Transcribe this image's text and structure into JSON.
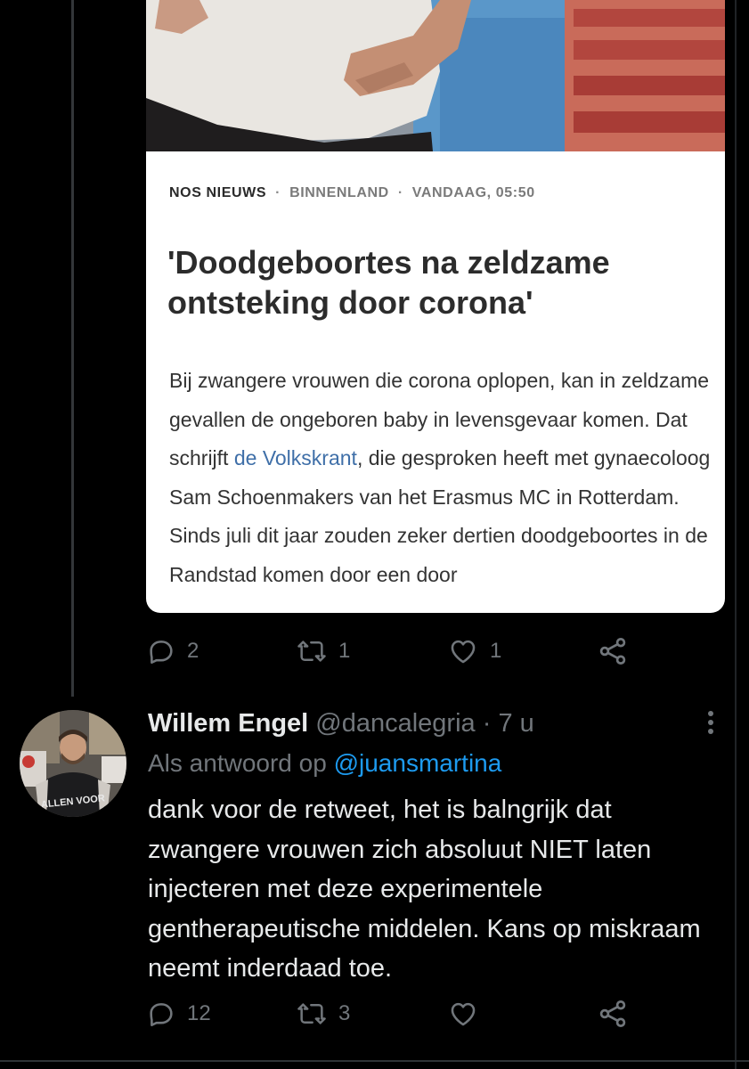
{
  "card": {
    "source": "NOS NIEUWS",
    "section": "BINNENLAND",
    "time": "VANDAAG, 05:50",
    "separator": "·",
    "title": "'Doodgeboortes na zeldzame ontsteking door corona'",
    "body_part1": "Bij zwangere vrouwen die corona oplopen, kan in zeldzame gevallen de ongeboren baby in levensgevaar komen. Dat schrijft ",
    "body_link": "de Volkskrant",
    "body_part2": ", die gesproken heeft met gynaecoloog Sam Schoenmakers van het Erasmus MC in Rotterdam. Sinds juli dit jaar zouden zeker dertien doodgeboortes in de Randstad komen door een door"
  },
  "quoted_actions": {
    "replies": "2",
    "retweets": "1",
    "likes": "1"
  },
  "reply": {
    "name": "Willem Engel",
    "handle": "@dancalegria",
    "separator": "·",
    "time": "7 u",
    "reply_to_prefix": "Als antwoord op",
    "reply_to_handle": "@juansmartina",
    "text": "dank voor de retweet, het is balngrijk dat zwangere vrouwen zich absoluut NIET laten injecteren met deze experimentele gentherapeutische middelen. Kans op miskraam neemt inderdaad toe.",
    "avatar_shirt_text": "ALLEN VOOR",
    "actions": {
      "replies": "12",
      "retweets": "3"
    }
  },
  "icons": {
    "reply": "reply-icon",
    "retweet": "retweet-icon",
    "like": "heart-icon",
    "share": "share-icon",
    "more": "more-icon"
  },
  "colors": {
    "background": "#000000",
    "text": "#e7e9ea",
    "muted": "#71767b",
    "accent": "#1d9bf0",
    "card_link": "#3f6fa8"
  }
}
